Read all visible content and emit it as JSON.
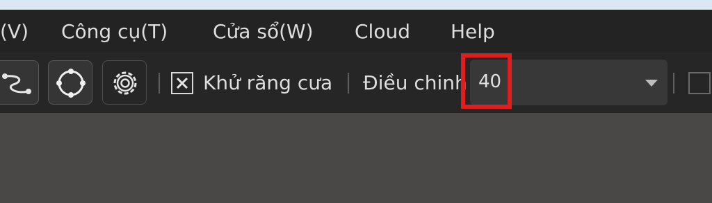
{
  "menubar": {
    "items": [
      {
        "label": "(V)"
      },
      {
        "label": "Công cụ(T)"
      },
      {
        "label": "Cửa sổ(W)"
      },
      {
        "label": "Cloud"
      },
      {
        "label": "Help"
      }
    ]
  },
  "toolbar": {
    "tools": [
      {
        "icon": "curve-path-icon"
      },
      {
        "icon": "circle-nodes-icon"
      },
      {
        "icon": "gear-icon"
      }
    ],
    "antialias": {
      "label": "Khử răng cưa",
      "checked": true
    },
    "adjust": {
      "label": "Điều chinh",
      "value": "40"
    }
  },
  "colors": {
    "menubar_bg": "#232323",
    "toolbar_bg": "#262626",
    "canvas_bg": "#4a4846",
    "highlight": "#e01e1e"
  }
}
